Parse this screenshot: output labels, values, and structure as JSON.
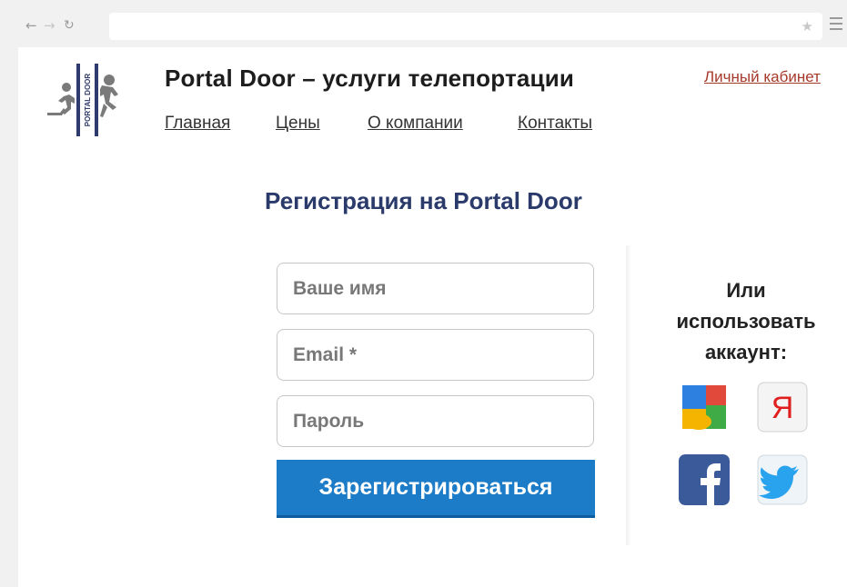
{
  "browser": {
    "back_icon": "back-arrow-icon",
    "forward_icon": "forward-arrow-icon",
    "reload_icon": "reload-icon",
    "bookmark_icon": "star-icon",
    "menu_icon": "hamburger-menu-icon"
  },
  "header": {
    "logo_text": "PORTAL DOOR",
    "title": "Portal Door – услуги телепортации",
    "account_link": "Личный кабинет",
    "nav": [
      "Главная",
      "Цены",
      "О компании",
      "Контакты"
    ]
  },
  "registration": {
    "heading": "Регистрация на Portal Door",
    "name_placeholder": "Ваше имя",
    "email_placeholder": "Email *",
    "password_placeholder": "Пароль",
    "submit_label": "Зарегистрироваться"
  },
  "social": {
    "heading": "Или использовать аккаунт:",
    "providers": [
      "google-icon",
      "yandex-icon",
      "facebook-icon",
      "twitter-icon"
    ],
    "yandex_letter": "Я"
  },
  "colors": {
    "accent": "#1c7cc8",
    "heading": "#2a3a6a",
    "link": "#a63a2a"
  }
}
